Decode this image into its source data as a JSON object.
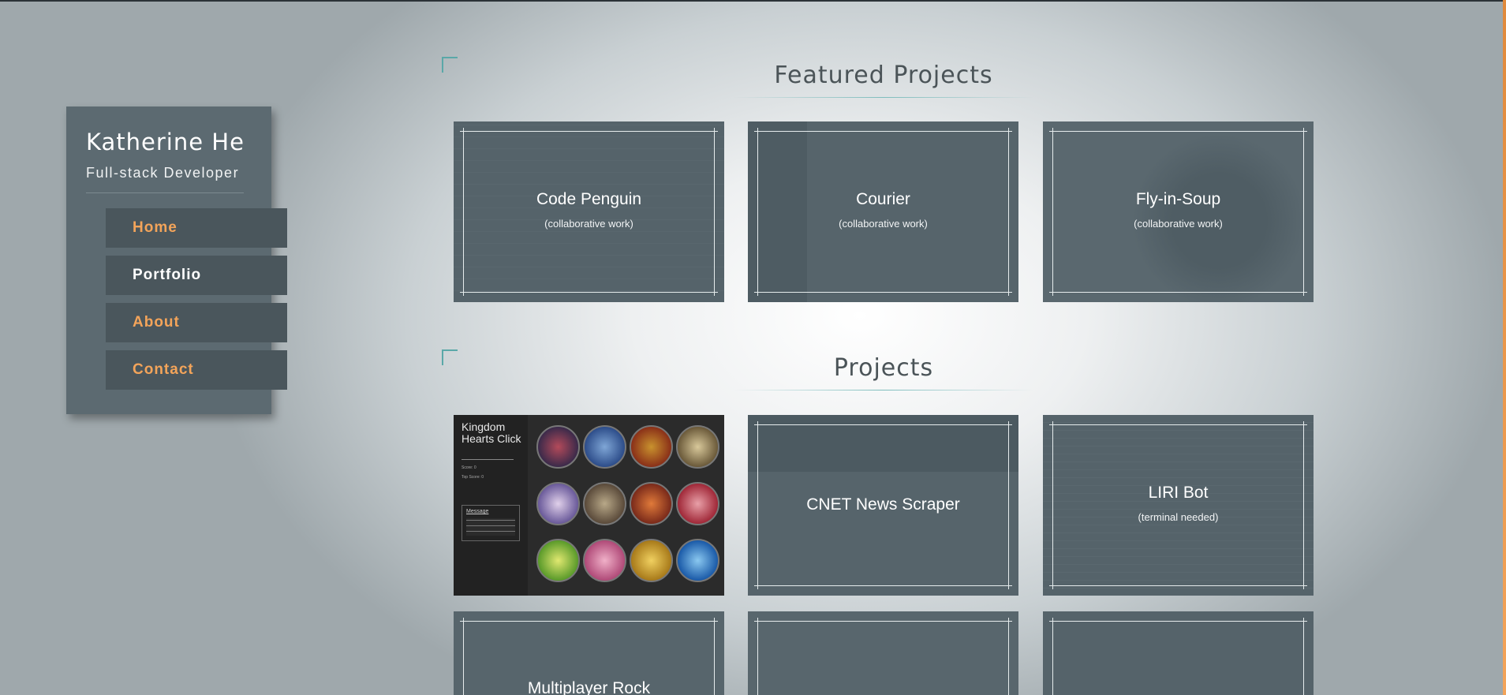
{
  "sidebar": {
    "name": "Katherine He",
    "role": "Full-stack Developer",
    "nav": [
      {
        "label": "Home",
        "active": false
      },
      {
        "label": "Portfolio",
        "active": true
      },
      {
        "label": "About",
        "active": false
      },
      {
        "label": "Contact",
        "active": false
      }
    ]
  },
  "featured": {
    "title": "Featured Projects",
    "cards": [
      {
        "title": "Code Penguin",
        "subtitle": "(collaborative work)"
      },
      {
        "title": "Courier",
        "subtitle": "(collaborative work)"
      },
      {
        "title": "Fly-in-Soup",
        "subtitle": "(collaborative work)"
      }
    ]
  },
  "projects": {
    "title": "Projects",
    "kingdom_hearts": {
      "title": "Kingdom Hearts Click",
      "score": "Score: 0",
      "top_score": "Top Score: 0",
      "message_label": "Message"
    },
    "cards": [
      {
        "title": "CNET News Scraper",
        "subtitle": ""
      },
      {
        "title": "LIRI Bot",
        "subtitle": "(terminal needed)"
      },
      {
        "title": "Multiplayer Rock",
        "subtitle": ""
      }
    ]
  },
  "colors": {
    "accent": "#f3a45a",
    "card_overlay": "#55636a",
    "sidebar": "#5c6a71",
    "heading_rule": "#5aa8a8"
  }
}
